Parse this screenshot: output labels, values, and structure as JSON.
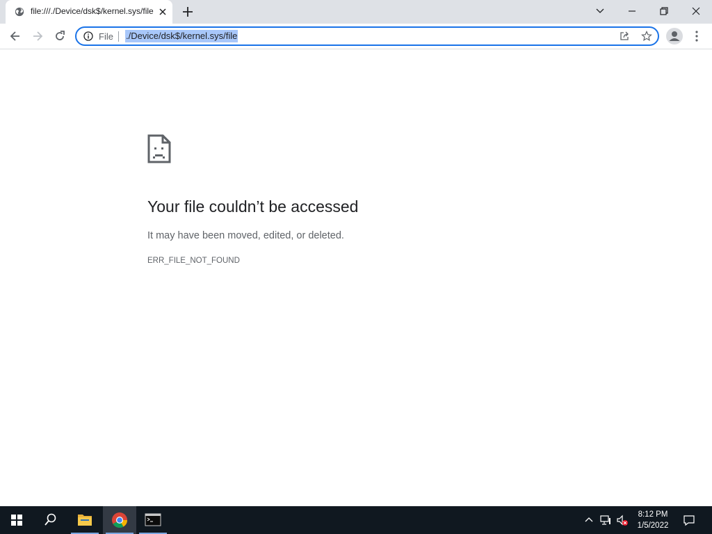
{
  "browser": {
    "tab": {
      "title": "file:///./Device/dsk$/kernel.sys/file",
      "favicon": "globe-icon",
      "close_icon": "close-icon"
    },
    "new_tab_icon": "plus-icon",
    "window_controls": [
      "chevron-down-icon",
      "minimize-icon",
      "restore-icon",
      "close-icon"
    ],
    "toolbar": {
      "back_icon": "arrow-left-icon",
      "forward_icon": "arrow-right-icon",
      "reload_icon": "reload-icon",
      "security_chip_label": "File",
      "url": "./Device/dsk$/kernel.sys/file",
      "share_icon": "share-icon",
      "bookmark_icon": "star-icon",
      "profile_icon": "person-icon",
      "menu_icon": "kebab-menu-icon"
    }
  },
  "error_page": {
    "icon": "sad-file-icon",
    "title": "Your file couldn’t be accessed",
    "description": "It may have been moved, edited, or deleted.",
    "code": "ERR_FILE_NOT_FOUND"
  },
  "taskbar": {
    "items": [
      "windows-start-icon",
      "search-icon",
      "file-explorer-icon",
      "chrome-icon",
      "terminal-icon"
    ],
    "active_item": "chrome-icon",
    "tray": [
      "chevron-up-icon",
      "network-icon",
      "volume-muted-icon"
    ],
    "time": "8:12 PM",
    "date": "1/5/2022",
    "notification_icon": "action-center-icon"
  },
  "colors": {
    "accent": "#1a73e8",
    "url_selection": "#a8c7fa",
    "taskbar_bg": "#101820",
    "tab_strip_bg": "#dee1e6"
  }
}
